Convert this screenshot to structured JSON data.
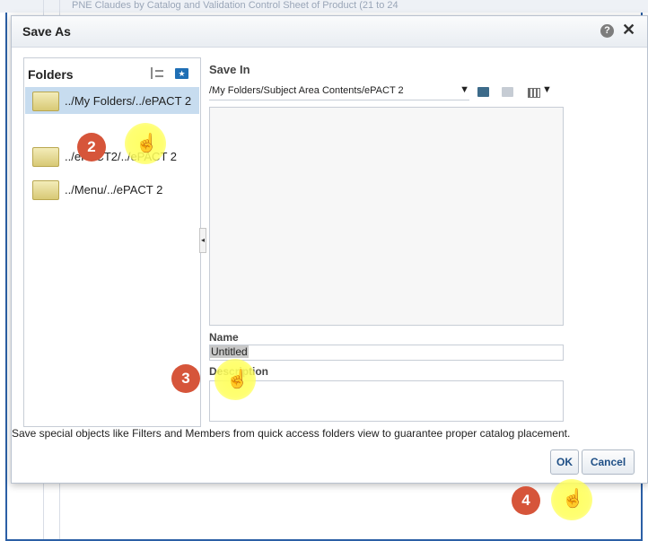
{
  "background": {
    "title": "PNE Claudes by Catalog and Validation Control Sheet of Product (21 to 24"
  },
  "dialog": {
    "title": "Save As",
    "help_glyph": "?",
    "close_glyph": "✕"
  },
  "folders": {
    "title": "Folders",
    "items": [
      {
        "label": "../My Folders/../ePACT 2",
        "selected": true
      },
      {
        "label": "../ePACT2/../ePACT 2",
        "selected": false
      },
      {
        "label": "../Menu/../ePACT 2",
        "selected": false
      }
    ]
  },
  "save_in": {
    "label": "Save In",
    "value": "/My Folders/Subject Area Contents/ePACT 2",
    "arrow": "▼"
  },
  "name": {
    "label": "Name",
    "value": "Untitled"
  },
  "description": {
    "label": "Description",
    "value": ""
  },
  "note": "Save special objects like Filters and Members from quick access folders view to guarantee proper catalog placement.",
  "buttons": {
    "ok": "OK",
    "cancel": "Cancel"
  },
  "annotations": {
    "step2": "2",
    "step3": "3",
    "step4": "4"
  },
  "icons": {
    "hand_cursor": "☝",
    "splitter_glyph": "◂"
  },
  "colors": {
    "badge": "#d6553a",
    "highlight": "#ffff5a",
    "selected_row": "#c7dcef",
    "button_text": "#1f4f86"
  }
}
